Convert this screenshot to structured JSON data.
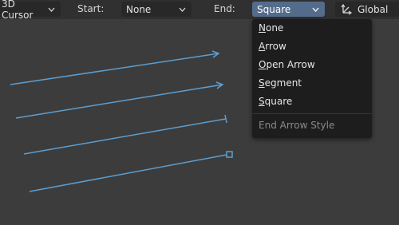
{
  "header": {
    "pivot_label": "3D Cursor",
    "start_label": "Start:",
    "start_value": "None",
    "end_label": "End:",
    "end_value": "Square",
    "orientation_label": "Global"
  },
  "menu": {
    "items": [
      {
        "label": "None",
        "mnemonic": "N",
        "rest": "one"
      },
      {
        "label": "Arrow",
        "mnemonic": "A",
        "rest": "rrow"
      },
      {
        "label": "Open Arrow",
        "mnemonic": "O",
        "rest": "pen Arrow"
      },
      {
        "label": "Segment",
        "mnemonic": "S",
        "rest": "egment"
      },
      {
        "label": "Square",
        "mnemonic": "S",
        "rest": "quare"
      }
    ],
    "title": "End Arrow Style"
  },
  "colors": {
    "stroke": "#5c9ed0",
    "active_dropdown": "#546c8c",
    "menu_bg": "#1d1d1d",
    "viewport_bg": "#3c3c3c"
  },
  "strokes": [
    {
      "end_style": "Open Arrow"
    },
    {
      "end_style": "Arrow"
    },
    {
      "end_style": "Segment"
    },
    {
      "end_style": "Square"
    }
  ]
}
